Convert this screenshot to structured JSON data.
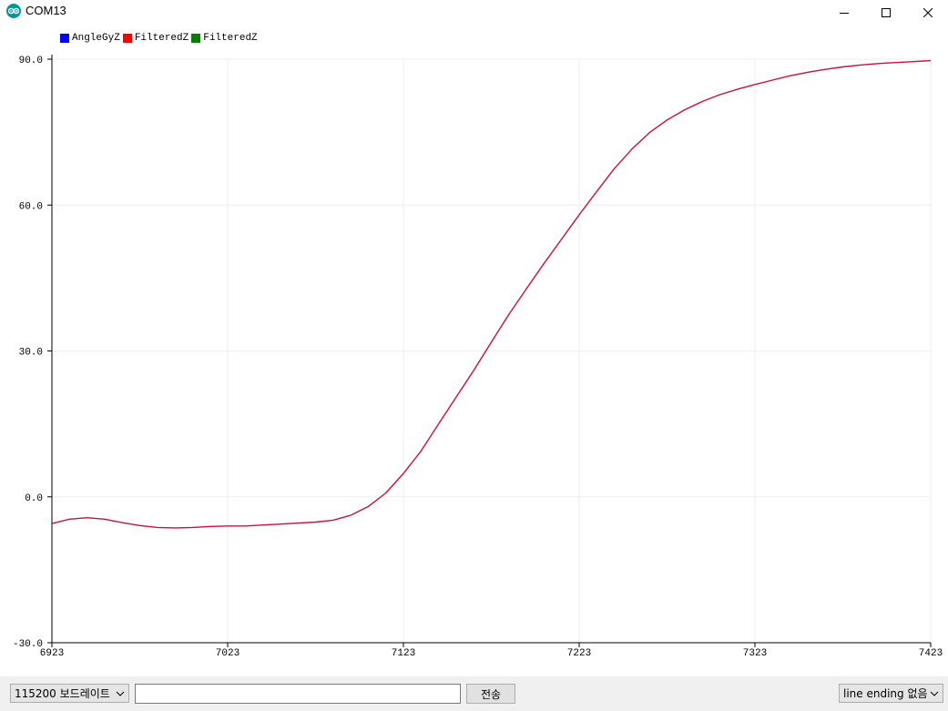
{
  "window": {
    "title": "COM13",
    "icon": "arduino-icon",
    "controls": [
      "minimize-icon",
      "maximize-icon",
      "close-icon"
    ]
  },
  "legend": [
    {
      "name": "AngleGyZ",
      "color": "#0000ff"
    },
    {
      "name": "FilteredZ",
      "color": "#ff0000"
    },
    {
      "name": "FilteredZ",
      "color": "#008000"
    }
  ],
  "chart_data": {
    "type": "line",
    "title": "",
    "xlabel": "",
    "ylabel": "",
    "xlim": [
      6923,
      7423
    ],
    "ylim": [
      -30.0,
      90.0
    ],
    "x_ticks": [
      "6923",
      "7023",
      "7123",
      "7223",
      "7323",
      "7423"
    ],
    "y_ticks": [
      "90.0",
      "60.0",
      "30.0",
      "0.0",
      "-30.0"
    ],
    "grid": true,
    "legend_position": "top-left",
    "line_color": "#c8103c",
    "x": [
      6923,
      6933,
      6943,
      6953,
      6963,
      6973,
      6983,
      6993,
      7003,
      7013,
      7023,
      7033,
      7043,
      7053,
      7063,
      7073,
      7083,
      7093,
      7103,
      7113,
      7123,
      7133,
      7143,
      7153,
      7163,
      7173,
      7183,
      7193,
      7203,
      7213,
      7223,
      7233,
      7243,
      7253,
      7263,
      7273,
      7283,
      7293,
      7303,
      7313,
      7323,
      7333,
      7343,
      7353,
      7363,
      7373,
      7383,
      7393,
      7403,
      7413,
      7423
    ],
    "y": [
      -5.5,
      -4.6,
      -4.3,
      -4.6,
      -5.3,
      -5.9,
      -6.3,
      -6.4,
      -6.3,
      -6.1,
      -6.0,
      -6.0,
      -5.8,
      -5.6,
      -5.4,
      -5.2,
      -4.8,
      -3.8,
      -2.0,
      0.8,
      4.8,
      9.4,
      15.0,
      20.5,
      26.0,
      31.8,
      37.5,
      42.8,
      48.0,
      53.0,
      58.0,
      62.8,
      67.5,
      71.5,
      74.9,
      77.5,
      79.6,
      81.3,
      82.7,
      83.8,
      84.8,
      85.7,
      86.6,
      87.3,
      87.9,
      88.4,
      88.8,
      89.1,
      89.3,
      89.5,
      89.7
    ]
  },
  "bottom": {
    "baud_value": "115200 보드레이트",
    "input_value": "",
    "send_label": "전송",
    "line_ending_value": "line ending 없음"
  }
}
